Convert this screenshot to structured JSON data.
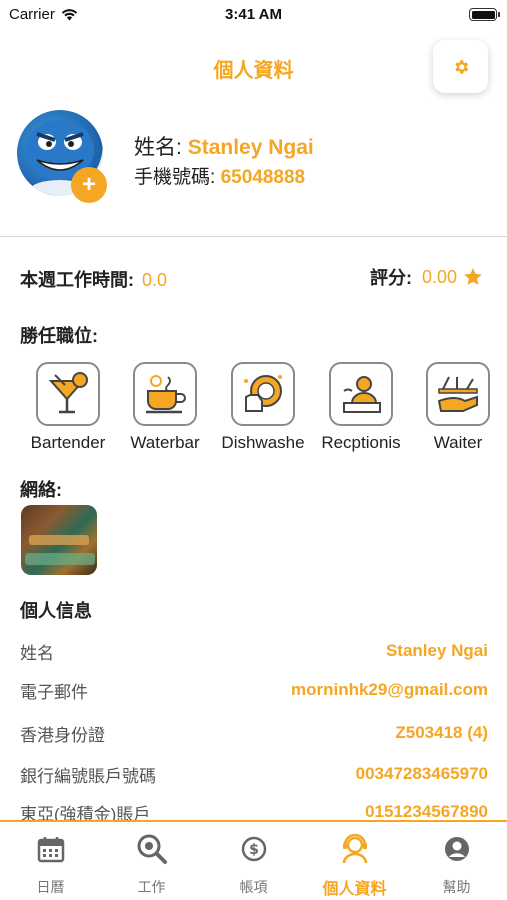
{
  "status_bar": {
    "carrier": "Carrier",
    "time": "3:41 AM"
  },
  "header": {
    "title": "個人資料",
    "settings_icon": "gear-icon"
  },
  "profile": {
    "name_label": "姓名:",
    "name": "Stanley Ngai",
    "phone_label": "手機號碼:",
    "phone": "65048888",
    "add_photo": "+"
  },
  "stats": {
    "hours_label": "本週工作時間:",
    "hours_value": "0.0",
    "rating_label": "評分:",
    "rating_value": "0.00"
  },
  "positions": {
    "title": "勝任職位:",
    "items": [
      {
        "label": "Bartender",
        "icon": "cocktail-icon"
      },
      {
        "label": "Waterbar",
        "icon": "tea-cup-icon"
      },
      {
        "label": "Dishwashe",
        "icon": "dishwashing-icon"
      },
      {
        "label": "Recptionis",
        "icon": "receptionist-icon"
      },
      {
        "label": "Waiter",
        "icon": "waiter-tray-icon"
      }
    ]
  },
  "network": {
    "title": "網絡:"
  },
  "personal_info": {
    "title": "個人信息",
    "rows": [
      {
        "label": "姓名",
        "value": "Stanley Ngai"
      },
      {
        "label": "電子郵件",
        "value": "morninhk29@gmail.com"
      },
      {
        "label": "香港身份證",
        "value": "Z503418 (4)"
      },
      {
        "label": "銀行編號賬戶號碼",
        "value": "00347283465970"
      },
      {
        "label": "東亞(強積金)賬戶",
        "value": "0151234567890"
      }
    ]
  },
  "tab_bar": {
    "items": [
      {
        "label": "日曆",
        "icon": "calendar-icon",
        "active": false
      },
      {
        "label": "工作",
        "icon": "search-icon",
        "active": false
      },
      {
        "label": "帳項",
        "icon": "dollar-icon",
        "active": false
      },
      {
        "label": "個人資料",
        "icon": "profile-icon",
        "active": true
      },
      {
        "label": "幫助",
        "icon": "user-circle-icon",
        "active": false
      }
    ]
  },
  "colors": {
    "accent": "#f5a623",
    "divider": "#d6d6d6"
  }
}
